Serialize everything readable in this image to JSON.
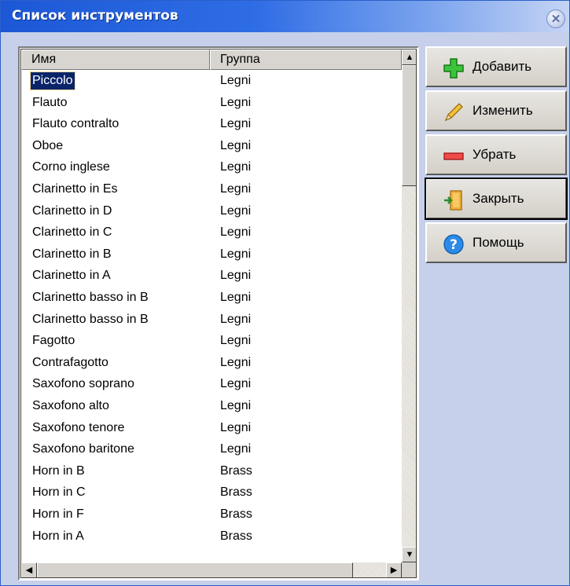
{
  "window": {
    "title": "Список инструментов"
  },
  "list": {
    "columns": [
      "Имя",
      "Группа"
    ],
    "rows": [
      {
        "name": "Piccolo",
        "group": "Legni"
      },
      {
        "name": "Flauto",
        "group": "Legni"
      },
      {
        "name": "Flauto contralto",
        "group": "Legni"
      },
      {
        "name": "Oboe",
        "group": "Legni"
      },
      {
        "name": "Corno inglese",
        "group": "Legni"
      },
      {
        "name": "Clarinetto in Es",
        "group": "Legni"
      },
      {
        "name": "Clarinetto in D",
        "group": "Legni"
      },
      {
        "name": "Clarinetto in C",
        "group": "Legni"
      },
      {
        "name": "Clarinetto in B",
        "group": "Legni"
      },
      {
        "name": "Clarinetto in A",
        "group": "Legni"
      },
      {
        "name": "Clarinetto basso in B",
        "group": "Legni"
      },
      {
        "name": "Clarinetto basso in B",
        "group": "Legni"
      },
      {
        "name": "Fagotto",
        "group": "Legni"
      },
      {
        "name": "Contrafagotto",
        "group": "Legni"
      },
      {
        "name": "Saxofono soprano",
        "group": "Legni"
      },
      {
        "name": "Saxofono alto",
        "group": "Legni"
      },
      {
        "name": "Saxofono tenore",
        "group": "Legni"
      },
      {
        "name": "Saxofono baritone",
        "group": "Legni"
      },
      {
        "name": "Horn in B",
        "group": "Brass"
      },
      {
        "name": "Horn in C",
        "group": "Brass"
      },
      {
        "name": "Horn in F",
        "group": "Brass"
      },
      {
        "name": "Horn in A",
        "group": "Brass"
      }
    ],
    "selected_index": 0
  },
  "buttons": {
    "add": {
      "label": "Добавить",
      "icon": "plus-icon"
    },
    "edit": {
      "label": "Изменить",
      "icon": "pencil-icon"
    },
    "remove": {
      "label": "Убрать",
      "icon": "minus-icon"
    },
    "close": {
      "label": "Закрыть",
      "icon": "exit-door-icon"
    },
    "help": {
      "label": "Помощь",
      "icon": "help-icon"
    }
  },
  "colors": {
    "titlebar": "#2f6de5",
    "panel": "#c6d0eb",
    "selection": "#0a246a"
  }
}
